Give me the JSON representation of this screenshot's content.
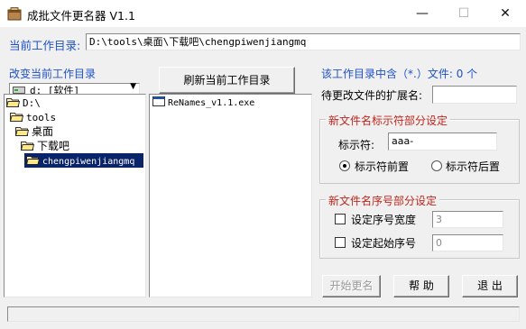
{
  "window": {
    "title": "成批文件更名器 V1.1",
    "minimize_glyph": "—",
    "maximize_glyph": "☐",
    "close_glyph": "✕"
  },
  "path_bar": {
    "label": "当前工作目录:",
    "value": "D:\\tools\\桌面\\下载吧\\chengpiwenjiangmq"
  },
  "left_panel": {
    "heading": "改变当前工作目录",
    "drive_select": "d: [软件]",
    "tree": [
      {
        "label": "D:\\",
        "selected": false
      },
      {
        "label": "tools",
        "selected": false
      },
      {
        "label": "桌面",
        "selected": false
      },
      {
        "label": "下载吧",
        "selected": false
      },
      {
        "label": "chengpiwenjiangmq",
        "selected": true
      }
    ]
  },
  "middle_panel": {
    "refresh_button": "刷新当前工作目录",
    "files": [
      "ReNames_v1.1.exe"
    ]
  },
  "right_panel": {
    "file_count_prefix": "该工作目录中含（*.）文件: ",
    "file_count": "0",
    "file_count_suffix": " 个",
    "ext_label": "待更改文件的扩展名:",
    "ext_value": "",
    "marker_group": {
      "legend": "新文件名标示符部分设定",
      "marker_label": "标示符:",
      "marker_value": "aaa-",
      "option_before": "标示符前置",
      "option_after": "标示符后置",
      "selected": "before"
    },
    "serial_group": {
      "legend": "新文件名序号部分设定",
      "width_label": "设定序号宽度",
      "width_value": "3",
      "width_checked": false,
      "start_label": "设定起始序号",
      "start_value": "0",
      "start_checked": false
    },
    "buttons": {
      "start": "开始更名",
      "help": "帮 助",
      "exit": "退 出"
    }
  },
  "status_bar": {
    "text": ""
  },
  "colors": {
    "selection": "#0a246a",
    "label_blue": "#1e50c8",
    "label_red": "#c0261c"
  }
}
